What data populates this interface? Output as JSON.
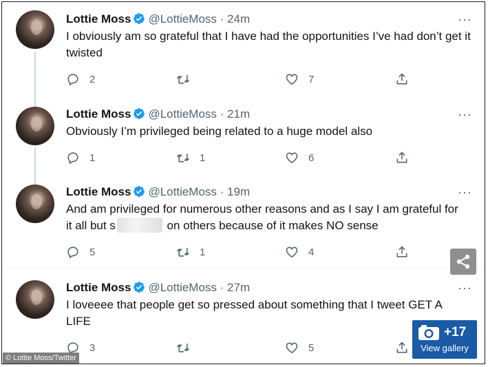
{
  "tweets": [
    {
      "name": "Lottie Moss",
      "handle": "@LottieMoss",
      "time": "24m",
      "text": "I obviously am so grateful that I have had the opportunities I’ve had don’t get it twisted",
      "replies": "2",
      "retweets": "",
      "likes": "7"
    },
    {
      "name": "Lottie Moss",
      "handle": "@LottieMoss",
      "time": "21m",
      "text": "Obviously I’m privileged being related to a huge model also",
      "replies": "1",
      "retweets": "1",
      "likes": "6"
    },
    {
      "name": "Lottie Moss",
      "handle": "@LottieMoss",
      "time": "19m",
      "text_line1": "And am privileged for numerous other reasons and as I say I am grateful for",
      "text_line2_pre": "it all but s",
      "text_line2_post": " on others because of it makes NO sense",
      "replies": "5",
      "retweets": "1",
      "likes": "4"
    },
    {
      "name": "Lottie Moss",
      "handle": "@LottieMoss",
      "time": "27m",
      "text": "I loveeee that people get so pressed about something that I tweet GET A LIFE",
      "replies": "3",
      "retweets": "",
      "likes": "5"
    }
  ],
  "separator": " · ",
  "more_glyph": "···",
  "credit": "© Lottie Moss/Twitter",
  "gallery": {
    "count": "+17",
    "label": "View gallery"
  },
  "colors": {
    "verified": "#1d9bf0",
    "muted": "#536471",
    "gallery": "#1a5aa6"
  }
}
